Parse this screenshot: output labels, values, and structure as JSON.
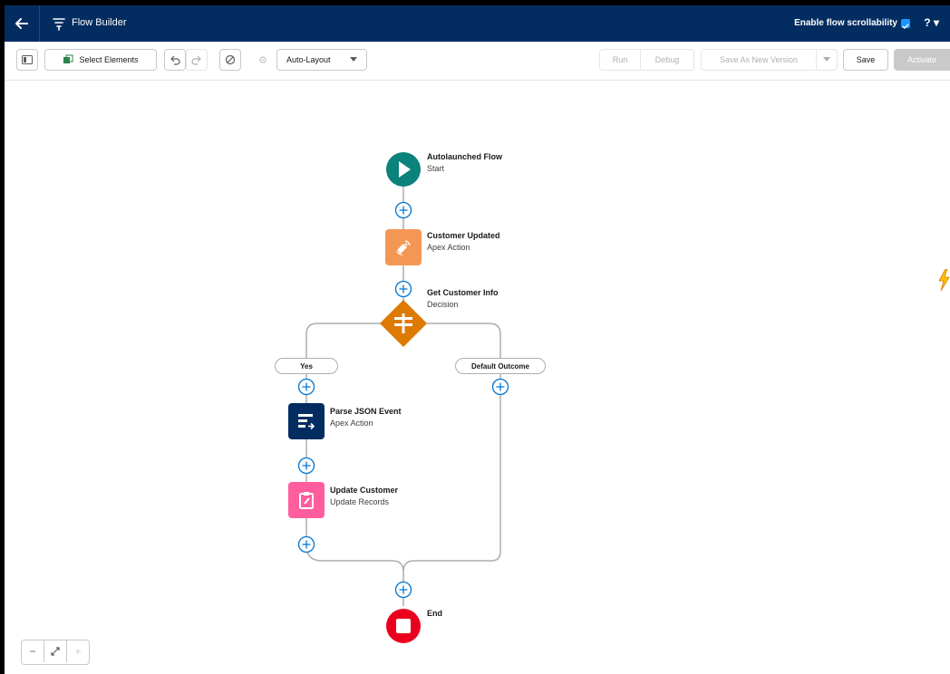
{
  "header": {
    "title": "Flow Builder",
    "scrollability_label": "Enable flow scrollability",
    "help_label": "?"
  },
  "toolbar": {
    "select_elements": "Select Elements",
    "layout_value": "Auto-Layout",
    "run": "Run",
    "debug": "Debug",
    "save_as_new_version": "Save As New Version",
    "save": "Save",
    "activate": "Activate"
  },
  "flow": {
    "start": {
      "title": "Autolaunched Flow",
      "subtitle": "Start"
    },
    "customer_updated": {
      "title": "Customer Updated",
      "subtitle": "Apex Action"
    },
    "decision": {
      "title": "Get Customer Info",
      "subtitle": "Decision"
    },
    "outcome_yes": "Yes",
    "outcome_default": "Default Outcome",
    "parse_json": {
      "title": "Parse JSON Event",
      "subtitle": "Apex Action"
    },
    "update_customer": {
      "title": "Update Customer",
      "subtitle": "Update Records"
    },
    "end": {
      "title": "End"
    }
  },
  "colors": {
    "header_bg": "#032d60",
    "start": "#0b827c",
    "apex_action": "#f49756",
    "decision": "#dd7a01",
    "parse_json": "#032d60",
    "update_records": "#ff5d9e",
    "end": "#ea001e"
  },
  "icons": [
    "back-arrow-icon",
    "flow-builder-icon",
    "toggle-panel-icon",
    "undo-icon",
    "redo-icon",
    "cancel-circle-icon",
    "settings-icon",
    "chevron-down-icon",
    "play-icon",
    "satellite-icon",
    "decision-icon",
    "apex-icon",
    "update-records-icon",
    "stop-icon",
    "lightning-icon",
    "zoom-out-icon",
    "fit-view-icon",
    "zoom-in-icon"
  ]
}
